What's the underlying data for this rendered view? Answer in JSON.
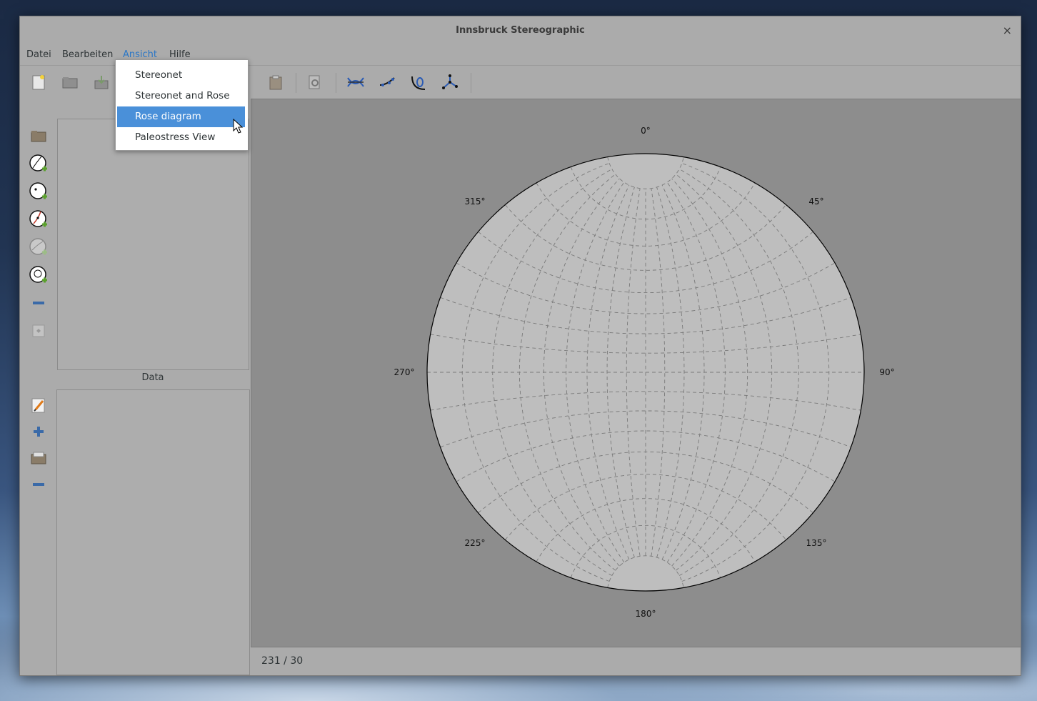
{
  "window": {
    "title": "Innsbruck Stereographic",
    "close_label": "×"
  },
  "menubar": [
    "Datei",
    "Bearbeiten",
    "Ansicht",
    "Hilfe"
  ],
  "dropdown": {
    "items": [
      "Stereonet",
      "Stereonet and Rose",
      "Rose diagram",
      "Paleostress View"
    ],
    "selected": "Rose diagram"
  },
  "toolbar_icons": [
    "new-file-icon",
    "open-folder-icon",
    "save-icon",
    "cut-icon",
    "copy-icon",
    "paste-icon",
    "zoom-icon",
    "fault-plane-icon",
    "linear-icon",
    "smallcircle-icon",
    "eigenvector-icon"
  ],
  "layers_icons": [
    "folder-icon",
    "add-plane-icon",
    "add-line-icon",
    "add-fault-icon",
    "add-smallcircle-icon",
    "add-circle-icon",
    "remove-icon",
    "properties-icon"
  ],
  "data_panel": {
    "label": "Data"
  },
  "data_icons": [
    "edit-icon",
    "add-row-icon",
    "open-data-icon",
    "remove-row-icon"
  ],
  "stereonet": {
    "azimuth_labels": [
      "0°",
      "45°",
      "90°",
      "135°",
      "180°",
      "225°",
      "270°",
      "315°"
    ]
  },
  "status": {
    "text": "231 / 30"
  }
}
